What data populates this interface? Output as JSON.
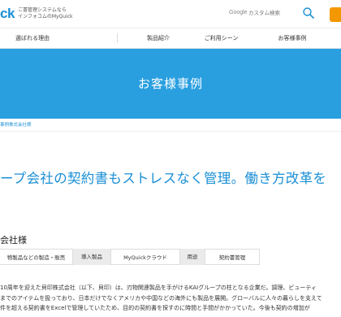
{
  "header": {
    "logo_text": "ck",
    "tagline_line1": "ご書管理システムなら",
    "tagline_line2": "インフォコムのMyQuick",
    "google_label": "Google",
    "search_placeholder": "カスタム検索"
  },
  "nav": {
    "items": [
      {
        "label": "選ばれる理由"
      },
      {
        "label": "製品紹介"
      },
      {
        "label": "ご利用シーン"
      },
      {
        "label": "お客様事例"
      }
    ]
  },
  "hero": {
    "title": "お客様事例"
  },
  "breadcrumb": "事例株式会社様",
  "headline": "ープ会社の契約書もストレスなく管理。働き方改革を",
  "company": "会社様",
  "chips": [
    {
      "text": "物製品などの製造・販売",
      "type": "value"
    },
    {
      "text": "導入製品",
      "type": "label"
    },
    {
      "text": "MyQuickクラウド",
      "type": "value"
    },
    {
      "text": "用途",
      "type": "label"
    },
    {
      "text": "契約書管理",
      "type": "value"
    }
  ],
  "body": {
    "line1": "10周年を迎えた貝印株式会社（以下、貝印）は、刃物関連製品を手がけるKAIグループの柱となる企業だ。調理、ビューティ",
    "line2": "までのアイテムを扱っており、日本だけでなくアメリカや中国などの海外にも製品を展開。グローバルに人々の暮らしを支えて",
    "line3": "件を超える契約書をExcelで管理していたため、目的の契約書を探すのに時間と手間がかかっていた。今後も契約の増加が"
  }
}
